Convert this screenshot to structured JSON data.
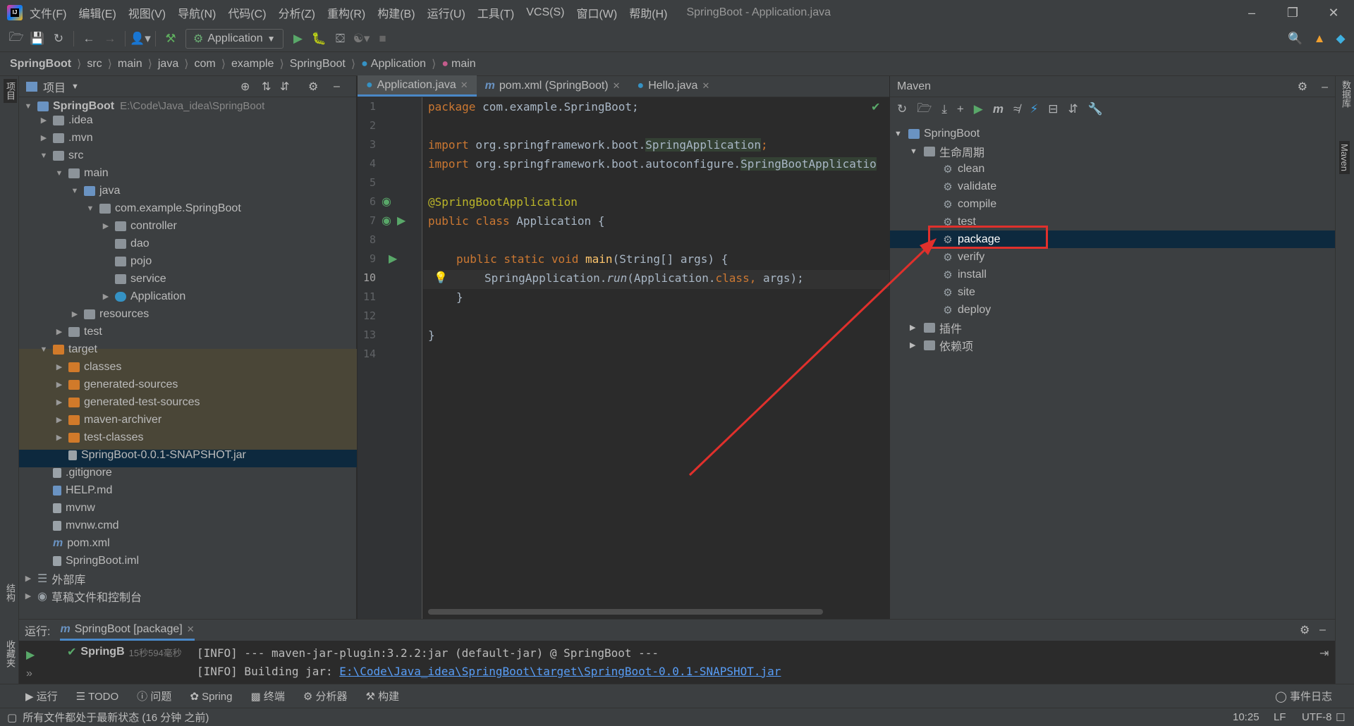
{
  "menubar": {
    "items": [
      "文件(F)",
      "编辑(E)",
      "视图(V)",
      "导航(N)",
      "代码(C)",
      "分析(Z)",
      "重构(R)",
      "构建(B)",
      "运行(U)",
      "工具(T)",
      "VCS(S)",
      "窗口(W)",
      "帮助(H)"
    ],
    "title": "SpringBoot - Application.java"
  },
  "toolbar": {
    "run_config": "Application"
  },
  "breadcrumb": [
    "SpringBoot",
    "src",
    "main",
    "java",
    "com",
    "example",
    "SpringBoot",
    "Application",
    "main"
  ],
  "left_strip": {
    "project": "项目",
    "structure": "结构",
    "favorites": "收藏夹"
  },
  "right_strip": {
    "database": "数据库",
    "maven": "Maven"
  },
  "project": {
    "title": "项目",
    "tree": [
      {
        "label": "SpringBoot",
        "path": "E:\\Code\\Java_idea\\SpringBoot"
      },
      {
        "label": ".idea"
      },
      {
        "label": ".mvn"
      },
      {
        "label": "src"
      },
      {
        "label": "main"
      },
      {
        "label": "java"
      },
      {
        "label": "com.example.SpringBoot"
      },
      {
        "label": "controller"
      },
      {
        "label": "dao"
      },
      {
        "label": "pojo"
      },
      {
        "label": "service"
      },
      {
        "label": "Application"
      },
      {
        "label": "resources"
      },
      {
        "label": "test"
      },
      {
        "label": "target"
      },
      {
        "label": "classes"
      },
      {
        "label": "generated-sources"
      },
      {
        "label": "generated-test-sources"
      },
      {
        "label": "maven-archiver"
      },
      {
        "label": "test-classes"
      },
      {
        "label": "SpringBoot-0.0.1-SNAPSHOT.jar"
      },
      {
        "label": ".gitignore"
      },
      {
        "label": "HELP.md"
      },
      {
        "label": "mvnw"
      },
      {
        "label": "mvnw.cmd"
      },
      {
        "label": "pom.xml"
      },
      {
        "label": "SpringBoot.iml"
      },
      {
        "label": "外部库"
      },
      {
        "label": "草稿文件和控制台"
      }
    ]
  },
  "editor": {
    "tabs": [
      "Application.java",
      "pom.xml (SpringBoot)",
      "Hello.java"
    ],
    "lines": [
      "1",
      "2",
      "3",
      "4",
      "5",
      "6",
      "7",
      "8",
      "9",
      "10",
      "11",
      "12",
      "13",
      "14"
    ],
    "code": {
      "l1a": "package",
      "l1b": " com.example.SpringBoot;",
      "l3a": "import",
      "l3b": " org.springframework.boot.",
      "l3c": "SpringApplication",
      ";": ";",
      "l4a": "import",
      "l4b": " org.springframework.boot.autoconfigure.",
      "l4c": "SpringBootApplicatio",
      "l6": "@SpringBootApplication",
      "l7a": "public class",
      "l7b": " Application {",
      "l9a": "public static void",
      "l9b": "main",
      "l9c": "(String[] args) {",
      "l10a": "SpringApplication.",
      "l10b": "run",
      "l10c": "(Application.",
      "l10d": "class",
      ", args);": ", args);",
      "l11": "}",
      "l13": "}"
    }
  },
  "maven": {
    "title": "Maven",
    "root": "SpringBoot",
    "lifecycle": "生命周期",
    "goals": [
      "clean",
      "validate",
      "compile",
      "test",
      "package",
      "verify",
      "install",
      "site",
      "deploy"
    ],
    "plugins": "插件",
    "dependencies": "依赖项"
  },
  "run": {
    "label": "运行:",
    "tab": "SpringBoot [package]",
    "tree_item": "SpringB",
    "tree_time": "15秒594毫秒",
    "log": [
      "[INFO] --- maven-jar-plugin:3.2.2:jar (default-jar) @ SpringBoot ---",
      "[INFO] Building jar: "
    ],
    "log_link": "E:\\Code\\Java_idea\\SpringBoot\\target\\SpringBoot-0.0.1-SNAPSHOT.jar"
  },
  "bottombar": {
    "items": [
      "运行",
      "TODO",
      "问题",
      "Spring",
      "终端",
      "分析器",
      "构建"
    ],
    "event_log": "事件日志"
  },
  "status": {
    "message": "所有文件都处于最新状态 (16 分钟 之前)",
    "position": "10:25",
    "line_sep": "LF",
    "encoding": "UTF-8"
  }
}
